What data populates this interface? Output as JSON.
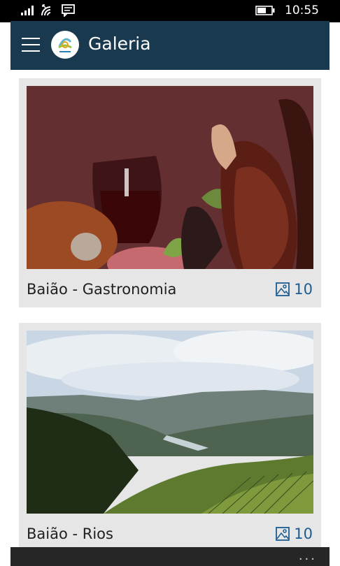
{
  "status_bar": {
    "time": "10:55"
  },
  "app_bar": {
    "title": "Galeria"
  },
  "gallery": [
    {
      "title": "Baião - Gastronomia",
      "count": "10"
    },
    {
      "title": "Baião - Rios",
      "count": "10"
    }
  ],
  "bottom_bar": {
    "more": "..."
  },
  "colors": {
    "app_bar": "#19394f",
    "accent": "#1c5c93",
    "card_bg": "#e6e6e6"
  }
}
